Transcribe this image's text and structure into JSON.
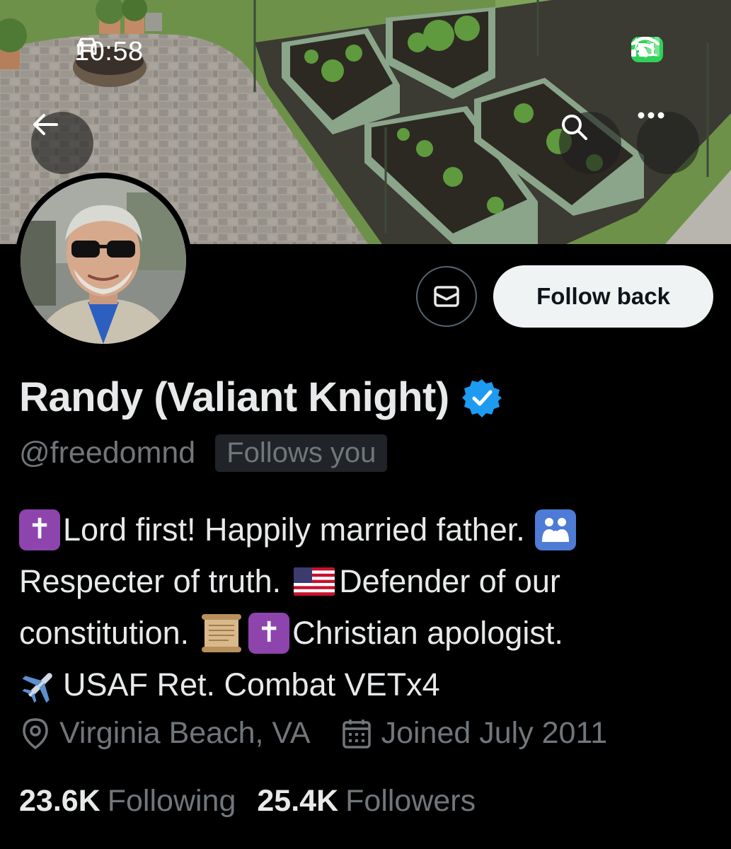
{
  "status_bar": {
    "time": "10:58",
    "battery": "51"
  },
  "profile": {
    "display_name": "Randy (Valiant Knight)",
    "handle": "@freedomnd",
    "follows_you_badge": "Follows you",
    "verified": true,
    "bio_lines": [
      "Lord first! Happily married father.",
      "Respecter of truth.",
      "Defender of our",
      "constitution.",
      "Christian apologist.",
      "USAF Ret. Combat VETx4"
    ],
    "location": "Virginia Beach, VA",
    "joined": "Joined July 2011",
    "following_count": "23.6K",
    "following_label": "Following",
    "followers_count": "25.4K",
    "followers_label": "Followers"
  },
  "actions": {
    "follow_back_label": "Follow back"
  },
  "colors": {
    "background": "#000000",
    "primary_text": "#e7e9ea",
    "secondary_text": "#71767b",
    "verified_blue": "#1d9bf0",
    "button_bg": "#eff3f4",
    "battery_green": "#30d158"
  },
  "icons": [
    "back-arrow-icon",
    "search-icon",
    "more-icon",
    "mail-icon",
    "verified-badge-icon",
    "location-pin-icon",
    "calendar-icon",
    "car-icon",
    "signal-icon",
    "wifi-icon"
  ]
}
